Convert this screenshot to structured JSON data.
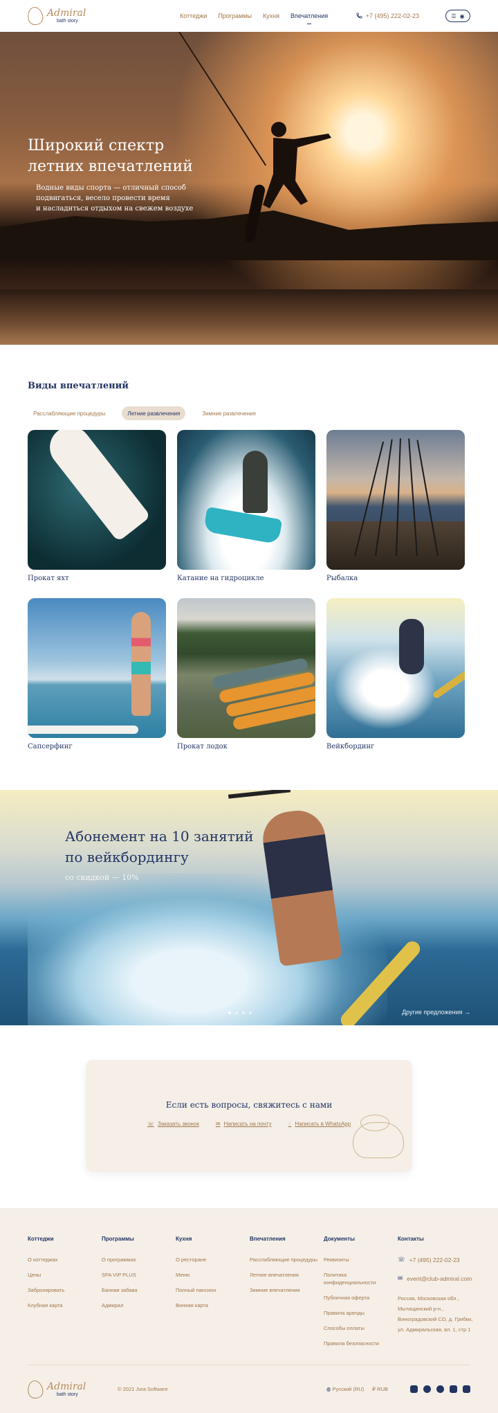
{
  "header": {
    "logo_name": "Admiral",
    "logo_sub": "bath story",
    "nav": [
      {
        "label": "Коттеджи"
      },
      {
        "label": "Программы"
      },
      {
        "label": "Кухня"
      },
      {
        "label": "Впечатления"
      }
    ],
    "phone": "+7 (495) 222-02-23"
  },
  "hero": {
    "title_line1": "Широкий спектр",
    "title_line2": "летних впечатлений",
    "text_line1": "Водные виды спорта — отличный способ",
    "text_line2": "подвигаться, весело провести время",
    "text_line3": "и насладиться отдыхом на свежем воздухе"
  },
  "experiences": {
    "title": "Виды впечатлений",
    "tabs": [
      {
        "label": "Расслабляющие процедуры"
      },
      {
        "label": "Летние развлечения"
      },
      {
        "label": "Зимние развлечения"
      }
    ],
    "cards": [
      {
        "title": "Прокат яхт"
      },
      {
        "title": "Катание на гидроцикле"
      },
      {
        "title": "Рыбалка"
      },
      {
        "title": "Сапсерфинг"
      },
      {
        "title": "Прокат лодок"
      },
      {
        "title": "Вейкбординг"
      }
    ]
  },
  "promo": {
    "title_line1": "Абонемент на 10 занятий",
    "title_line2": "по вейкбордингу",
    "subtitle": "со скидкой — 10%",
    "more": "Другие предложения"
  },
  "contact": {
    "title": "Если есть вопросы, свяжитесь с нами",
    "links": [
      {
        "label": "Заказать звонок"
      },
      {
        "label": "Написать на почту"
      },
      {
        "label": "Написать в WhatsApp"
      }
    ]
  },
  "footer": {
    "columns": [
      {
        "title": "Коттеджи",
        "items": [
          "О коттеджах",
          "Цены",
          "Забронировать",
          "Клубная карта"
        ]
      },
      {
        "title": "Программы",
        "items": [
          "О программах",
          "SPA VIP PLUS",
          "Банная забава",
          "Адмирал"
        ]
      },
      {
        "title": "Кухня",
        "items": [
          "О ресторане",
          "Меню",
          "Полный пансион",
          "Винная карта"
        ]
      },
      {
        "title": "Впечатления",
        "items": [
          "Расслабляющие процедуры",
          "Летние впечатления",
          "Зимние впечатления"
        ]
      },
      {
        "title": "Документы",
        "items": [
          "Реквизиты",
          "Политика конфиденциальности",
          "Публичная оферта",
          "Правила аренды",
          "Способы оплаты",
          "Правила безопасности"
        ]
      }
    ],
    "contacts_title": "Контакты",
    "phone": "+7 (495) 222-02-23",
    "email": "event@club-admiral.com",
    "address_line1": "Россия, Московская обл.,",
    "address_line2": "Мытищинский р-н.,",
    "address_line3": "Виноградовский СО, д. Грибки,",
    "address_line4": "ул. Адмиральская, вл. 1, стр 1",
    "copyright": "© 2021 Jura Software",
    "language": "Русский (RU)",
    "currency": "RUB"
  }
}
